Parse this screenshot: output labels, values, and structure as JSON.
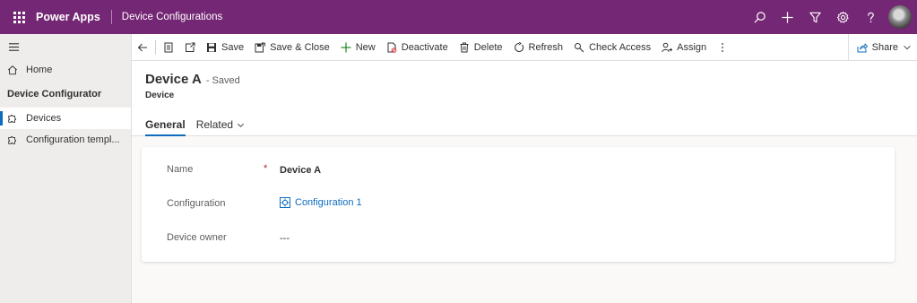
{
  "topbar": {
    "app_name": "Power Apps",
    "page_name": "Device Configurations",
    "icons": [
      "search-icon",
      "plus-icon",
      "filter-icon",
      "settings-icon",
      "help-icon",
      "avatar"
    ],
    "brand_color": "#742774"
  },
  "sidebar": {
    "home_label": "Home",
    "group_label": "Device Configurator",
    "items": [
      {
        "label": "Devices",
        "icon": "puzzle-icon",
        "active": true
      },
      {
        "label": "Configuration templ...",
        "icon": "puzzle-icon",
        "active": false
      }
    ]
  },
  "commandbar": {
    "save": "Save",
    "save_close": "Save & Close",
    "new": "New",
    "deactivate": "Deactivate",
    "delete": "Delete",
    "refresh": "Refresh",
    "check_access": "Check Access",
    "assign": "Assign",
    "share": "Share"
  },
  "record": {
    "title": "Device A",
    "status": "- Saved",
    "entity": "Device"
  },
  "tabs": [
    {
      "label": "General",
      "active": true
    },
    {
      "label": "Related",
      "active": false
    }
  ],
  "form": {
    "name_label": "Name",
    "required_marker": "*",
    "name_value": "Device A",
    "configuration_label": "Configuration",
    "configuration_value": "Configuration 1",
    "owner_label": "Device owner",
    "owner_value": "---"
  },
  "colors": {
    "accent": "#0f6cbd",
    "required": "#a4262c"
  }
}
